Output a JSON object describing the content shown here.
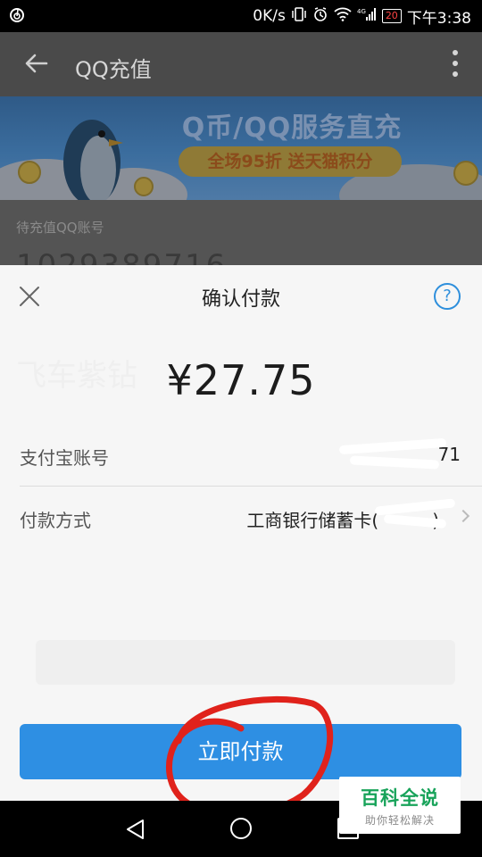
{
  "status_bar": {
    "netease_icon": "netease-music-icon",
    "speed": "0K/s",
    "battery_level": "20",
    "time": "下午3:38"
  },
  "app_bar": {
    "title": "QQ充值"
  },
  "banner": {
    "title": "Q币/QQ服务直充",
    "promo": "全场95折  送天猫积分"
  },
  "background": {
    "account_label": "待充值QQ账号",
    "account_number": "1029389716"
  },
  "sheet": {
    "title": "确认付款",
    "help": "?",
    "amount": "¥27.75",
    "alipay_label": "支付宝账号",
    "alipay_value": "71",
    "payment_label": "付款方式",
    "payment_value": "工商银行储蓄卡(",
    "payment_suffix": ")",
    "pay_button": "立即付款"
  },
  "watermark": {
    "title": "百科全说",
    "subtitle": "助你轻松解决"
  },
  "colors": {
    "accent": "#2e8fe3",
    "annotation": "#e0221b"
  }
}
